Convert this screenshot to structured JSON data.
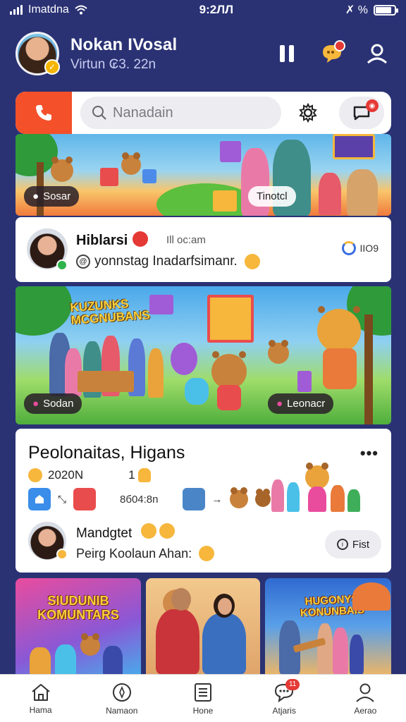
{
  "status_bar": {
    "carrier": "Imatdna",
    "time": "9:2ЛЛ",
    "right_text": "✗ %"
  },
  "header": {
    "user_name": "Nokan IVosal",
    "user_subtitle": "Virtun ₢3. 22n",
    "icons": [
      "pause-icon",
      "chat-bubble-icon",
      "profile-icon"
    ]
  },
  "search": {
    "placeholder": "Nanadain",
    "icons": [
      "phone-icon",
      "search-icon",
      "gear-icon",
      "chat-icon"
    ]
  },
  "banner1": {
    "left_label": "Sosar",
    "right_label": "Tinotcl"
  },
  "message": {
    "name": "Hiblarsi",
    "time": "Ill oc:am",
    "text": "yonnstag Inadarfsimanr.",
    "meta": "IIO9"
  },
  "banner2": {
    "title": "KUZUNKS\nMCGNUBANS",
    "left_label": "Sodan",
    "right_label": "Leonacr"
  },
  "group": {
    "title": "Peolonaitas, Higans",
    "stat_date": "2020N",
    "stat_count": "1",
    "row_text": "8б04:8n",
    "second_name": "Mandgtet",
    "second_text": "Peirg Koolaun Ahan:",
    "button_label": "Fist"
  },
  "tiles": {
    "tile1_title": "SIUDUNIB KOMUNTARS",
    "tile3_title": "HUGONYS KONUNBAIS"
  },
  "bottom_nav": [
    {
      "label": "Hama",
      "icon": "home-icon"
    },
    {
      "label": "Namaon",
      "icon": "compass-icon"
    },
    {
      "label": "Hone",
      "icon": "list-icon"
    },
    {
      "label": "Atjaris",
      "icon": "chat-icon",
      "badge": "11"
    },
    {
      "label": "Aerao",
      "icon": "profile-icon"
    }
  ],
  "colors": {
    "background": "#2a3274",
    "accent_orange": "#f4502a",
    "badge_red": "#e53935",
    "card": "#ffffff"
  }
}
